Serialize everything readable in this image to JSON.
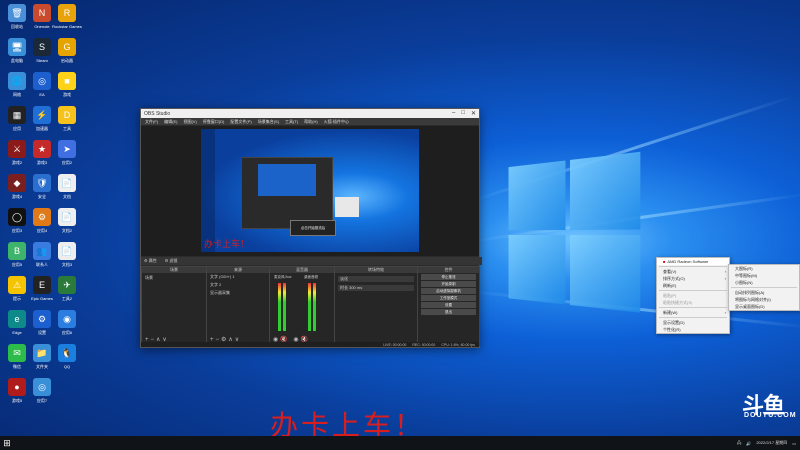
{
  "desktop_icons": [
    {
      "name": "recycle-bin",
      "label": "回收站",
      "color": "#4a90d9",
      "glyph": "🗑"
    },
    {
      "name": "onenote",
      "label": "Onenote",
      "color": "#c94a2d",
      "glyph": "N"
    },
    {
      "name": "rockstar",
      "label": "Rockstar Games",
      "color": "#e8a20c",
      "glyph": "R"
    },
    {
      "name": "computer",
      "label": "此电脑",
      "color": "#3a8fd9",
      "glyph": "🖥"
    },
    {
      "name": "steam",
      "label": "Steam",
      "color": "#1b2838",
      "glyph": "S"
    },
    {
      "name": "game-launcher",
      "label": "启动器",
      "color": "#e5a400",
      "glyph": "G"
    },
    {
      "name": "network",
      "label": "网络",
      "color": "#3a8fd9",
      "glyph": "🌐"
    },
    {
      "name": "ea",
      "label": "EA",
      "color": "#1e5fcf",
      "glyph": "◎"
    },
    {
      "name": "app-yellow",
      "label": "游戏",
      "color": "#ffd21a",
      "glyph": "■"
    },
    {
      "name": "app-dark",
      "label": "应用",
      "color": "#222",
      "glyph": "▦"
    },
    {
      "name": "app-blue",
      "label": "加速器",
      "color": "#1f6fd6",
      "glyph": "⚡"
    },
    {
      "name": "app-yellow2",
      "label": "工具",
      "color": "#f7c21b",
      "glyph": "D"
    },
    {
      "name": "game-red",
      "label": "游戏2",
      "color": "#8b1a1a",
      "glyph": "⚔"
    },
    {
      "name": "game-star",
      "label": "游戏3",
      "color": "#c42a2a",
      "glyph": "★"
    },
    {
      "name": "app-arrow",
      "label": "应用2",
      "color": "#3f6fe0",
      "glyph": "➤"
    },
    {
      "name": "app-game",
      "label": "游戏4",
      "color": "#7a1f1f",
      "glyph": "◆"
    },
    {
      "name": "shield",
      "label": "安全",
      "color": "#2a6fd0",
      "glyph": "🛡"
    },
    {
      "name": "doc",
      "label": "文档",
      "color": "#eee",
      "glyph": "📄"
    },
    {
      "name": "circle-app",
      "label": "应用3",
      "color": "#111",
      "glyph": "◯"
    },
    {
      "name": "orange-app",
      "label": "应用4",
      "color": "#e07a19",
      "glyph": "⚙"
    },
    {
      "name": "doc2",
      "label": "文档2",
      "color": "#eee",
      "glyph": "📄"
    },
    {
      "name": "green-app",
      "label": "应用5",
      "color": "#3db36c",
      "glyph": "B"
    },
    {
      "name": "people-app",
      "label": "联系人",
      "color": "#3a7be0",
      "glyph": "👥"
    },
    {
      "name": "doc3",
      "label": "文档3",
      "color": "#eee",
      "glyph": "📄"
    },
    {
      "name": "yellow-warn",
      "label": "提示",
      "color": "#f5c400",
      "glyph": "⚠"
    },
    {
      "name": "epic",
      "label": "Epic Games",
      "color": "#222",
      "glyph": "E"
    },
    {
      "name": "tool-app",
      "label": "工具2",
      "color": "#2a7a3a",
      "glyph": "✈"
    },
    {
      "name": "edge",
      "label": "Edge",
      "color": "#0f8a8a",
      "glyph": "e"
    },
    {
      "name": "gear-app",
      "label": "设置",
      "color": "#1c5fcf",
      "glyph": "⚙"
    },
    {
      "name": "app-blue2",
      "label": "应用6",
      "color": "#2b7de0",
      "glyph": "◉"
    },
    {
      "name": "wechat",
      "label": "微信",
      "color": "#2dbb4a",
      "glyph": "✉"
    },
    {
      "name": "folder",
      "label": "文件夹",
      "color": "#3a8fd9",
      "glyph": "📁"
    },
    {
      "name": "qq",
      "label": "QQ",
      "color": "#1b7fe0",
      "glyph": "🐧"
    },
    {
      "name": "game-circle",
      "label": "游戏5",
      "color": "#b01c1c",
      "glyph": "●"
    },
    {
      "name": "app-blue3",
      "label": "应用7",
      "color": "#3a8fd9",
      "glyph": "◎"
    }
  ],
  "obs": {
    "title": "OBS Studio",
    "menu": [
      "文件(F)",
      "编辑(E)",
      "视图(V)",
      "停靠窗口(D)",
      "配置文件(P)",
      "场景集合(S)",
      "工具(T)",
      "帮助(H)",
      "火狐·插件中心"
    ],
    "toolbar_items": [
      "属性",
      "滤镜"
    ],
    "docks": {
      "scenes": {
        "title": "场景",
        "items": [
          "场景"
        ]
      },
      "sources": {
        "title": "来源",
        "items": [
          "文字 (GDI+) 1",
          "文字 2",
          "显示器采集"
        ]
      },
      "mixer": {
        "title": "混音器",
        "items": [
          "麦克风/Aux",
          "桌面音频"
        ]
      },
      "transitions": {
        "title": "转场特效",
        "items": [
          "淡化",
          "时长 300 ms"
        ]
      },
      "controls": {
        "title": "控件",
        "buttons": [
          "停止推流",
          "开始录制",
          "启动虚拟摄像机",
          "工作室模式",
          "设置",
          "退出"
        ]
      }
    },
    "status": [
      "LIVE: 00:00:00",
      "REC: 00:00:00",
      "CPU: 1.6%, 60.00 fps"
    ],
    "preview_popup": "点击开始推流后"
  },
  "context_menu": {
    "header": "AMD Radeon Software",
    "items": [
      {
        "label": "查看(V)",
        "arrow": true,
        "disabled": false
      },
      {
        "label": "排序方式(O)",
        "arrow": true,
        "disabled": false
      },
      {
        "label": "刷新(E)",
        "arrow": false,
        "disabled": false
      },
      {
        "label": "粘贴(P)",
        "arrow": false,
        "disabled": true
      },
      {
        "label": "粘贴快捷方式(S)",
        "arrow": false,
        "disabled": true
      },
      {
        "label": "新建(W)",
        "arrow": true,
        "disabled": false
      },
      {
        "label": "显示设置(D)",
        "arrow": false,
        "disabled": false
      },
      {
        "label": "个性化(R)",
        "arrow": false,
        "disabled": false
      }
    ],
    "submenu": [
      "大图标(R)",
      "中等图标(M)",
      "小图标(N)",
      "自动排列图标(A)",
      "将图标与网格对齐(I)",
      "显示桌面图标(D)"
    ]
  },
  "overlay_text": "办卡上车！",
  "watermark": {
    "main": "斗鱼",
    "sub": "DOUYU.COM"
  },
  "taskbar": {
    "time": "",
    "date": "2022/2/17 星期四"
  }
}
